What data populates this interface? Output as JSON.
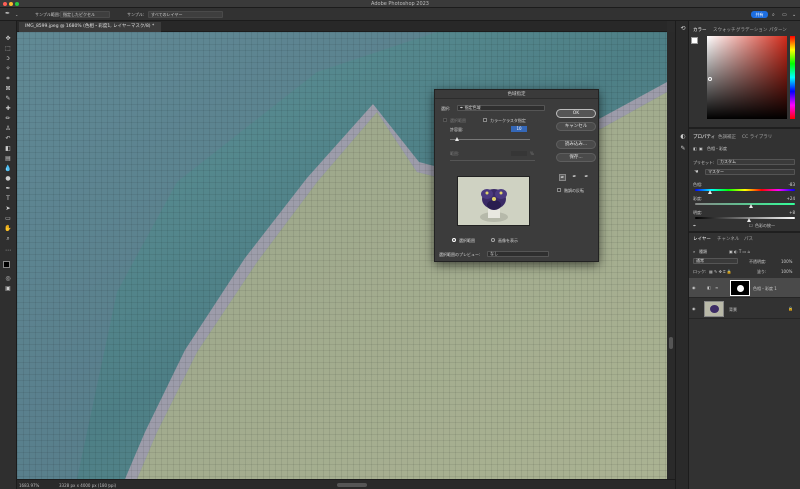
{
  "window": {
    "title": "Adobe Photoshop 2023"
  },
  "options_bar": {
    "sample_size_label": "サンプル範囲:",
    "sample_size_value": "指定したピクセル",
    "sample_label": "サンプル:",
    "sample_value": "すべてのレイヤー",
    "share_label": "共有"
  },
  "document_tab": {
    "label": "IMG_8599.jpeg @ 1680% (色相・彩度1, レイヤーマスク/8) *"
  },
  "status_bar": {
    "zoom": "1683.97%",
    "doc_info": "3328 px x 4000 px (180 ppi)"
  },
  "color_panel": {
    "tabs": [
      "カラー",
      "スウォッチ",
      "グラデーション",
      "パターン"
    ],
    "active_tab": 0,
    "hue_accent": "#d12a1a"
  },
  "properties_panel": {
    "tabs": [
      "プロパティ",
      "色調補正",
      "CC ライブラリ"
    ],
    "header": "色相・彩度",
    "preset_label": "プリセット:",
    "preset_value": "カスタム",
    "channel_value": "マスター",
    "hue_label": "色相:",
    "hue_value": "-83",
    "saturation_label": "彩度:",
    "saturation_value": "+24",
    "lightness_label": "明度:",
    "lightness_value": "+8",
    "colorize_label": "色彩の統一"
  },
  "layers_panel": {
    "tabs": [
      "レイヤー",
      "チャンネル",
      "パス"
    ],
    "kind_label": "種類",
    "blend_mode": "通常",
    "opacity_label": "不透明度:",
    "opacity_value": "100%",
    "lock_label": "ロック:",
    "fill_label": "塗り:",
    "fill_value": "100%",
    "layers": [
      {
        "name": "色相・彩度 1"
      },
      {
        "name": "背景"
      }
    ]
  },
  "dialog": {
    "title": "色域指定",
    "select_label": "選択:",
    "select_value": "指定色域",
    "localized_label": "選択範囲",
    "localized_color_clusters_label": "カラークラスタ指定",
    "fuzziness_label": "許容量:",
    "fuzziness_value": "10",
    "range_label": "範囲:",
    "range_value": "%",
    "ok_label": "OK",
    "cancel_label": "キャンセル",
    "load_label": "読み込み...",
    "save_label": "保存...",
    "invert_label": "階調の反転",
    "selection_radio_label": "選択範囲",
    "image_radio_label": "画像を表示",
    "preview_label": "選択範囲のプレビュー:",
    "preview_value": "なし"
  }
}
